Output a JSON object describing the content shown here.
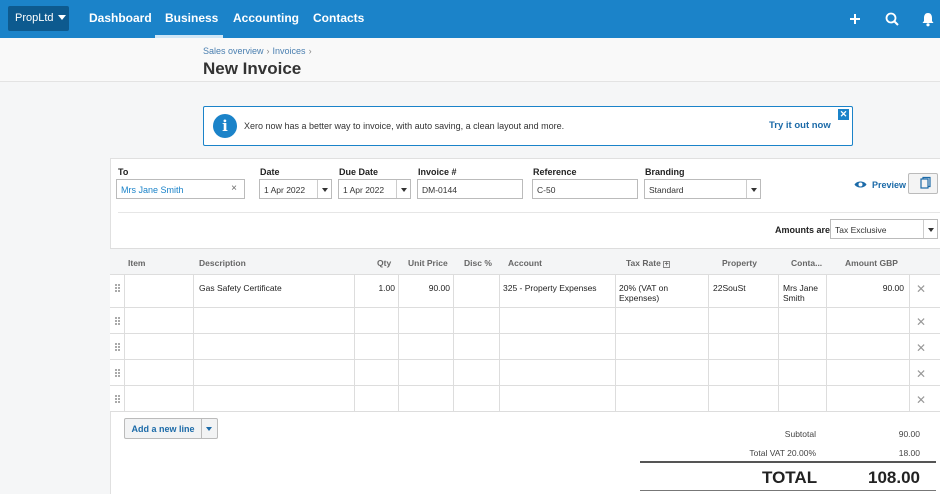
{
  "nav": {
    "org": "PropLtd",
    "items": [
      "Dashboard",
      "Business",
      "Accounting",
      "Contacts"
    ],
    "active": "Business"
  },
  "header": {
    "breadcrumb": [
      "Sales overview",
      "Invoices"
    ],
    "title": "New Invoice"
  },
  "banner": {
    "message": "Xero now has a better way to invoice, with auto saving, a clean layout and more.",
    "cta": "Try it out now"
  },
  "form": {
    "to_label": "To",
    "to_value": "Mrs Jane Smith",
    "date_label": "Date",
    "date_value": "1 Apr 2022",
    "due_label": "Due Date",
    "due_value": "1 Apr 2022",
    "invoice_label": "Invoice #",
    "invoice_value": "DM-0144",
    "reference_label": "Reference",
    "reference_value": "C-50",
    "branding_label": "Branding",
    "branding_value": "Standard",
    "preview_label": "Preview",
    "amounts_label": "Amounts are",
    "amounts_value": "Tax Exclusive"
  },
  "table": {
    "headers": [
      "Item",
      "Description",
      "Qty",
      "Unit Price",
      "Disc %",
      "Account",
      "Tax Rate",
      "Property",
      "Conta...",
      "Amount GBP"
    ],
    "rows": [
      {
        "item": "",
        "description": "Gas Safety Certificate",
        "qty": "1.00",
        "unit_price": "90.00",
        "disc": "",
        "account": "325 - Property Expenses",
        "tax_rate_1": "20% (VAT on",
        "tax_rate_2": "Expenses)",
        "property": "22SouSt",
        "contact_1": "Mrs Jane",
        "contact_2": "Smith",
        "amount": "90.00"
      }
    ]
  },
  "actions": {
    "add_line": "Add a new line"
  },
  "summary": {
    "subtotal_label": "Subtotal",
    "subtotal": "90.00",
    "vat_label": "Total VAT 20.00%",
    "vat": "18.00",
    "total_label": "TOTAL",
    "total": "108.00"
  },
  "colors": {
    "brand": "#1b83c9",
    "link": "#1b6aa8"
  }
}
